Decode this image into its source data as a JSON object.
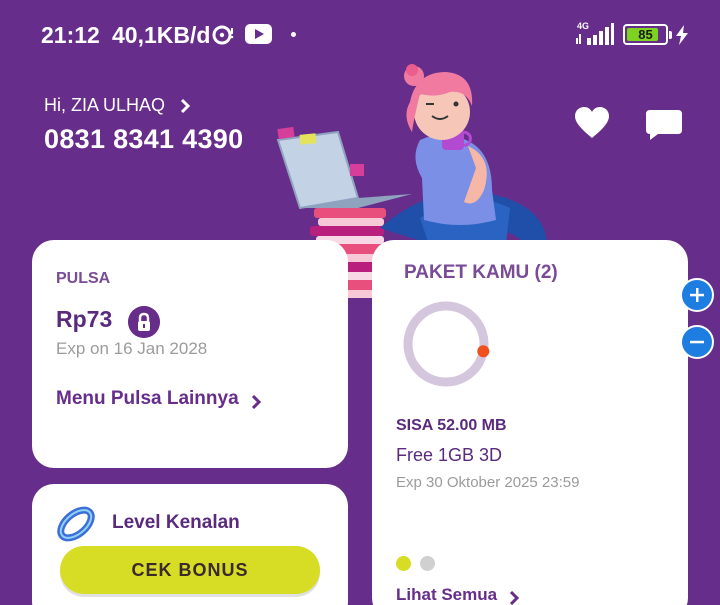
{
  "status_bar": {
    "time": "21:12",
    "speed": "40,1KB/d",
    "network": "4G",
    "battery": "85",
    "battery_fraction": 0.85
  },
  "header": {
    "greeting": "Hi, ZIA ULHAQ",
    "phone": "0831 8341 4390"
  },
  "pulsa": {
    "title": "PULSA",
    "amount": "Rp73",
    "expiry": "Exp on 16 Jan 2028",
    "menu_label": "Menu Pulsa Lainnya"
  },
  "level": {
    "label": "Level Kenalan",
    "button_label": "CEK BONUS"
  },
  "paket": {
    "title": "PAKET KAMU (2)",
    "remaining": "SISA 52.00 MB",
    "name": "Free 1GB 3D",
    "expiry": "Exp 30 Oktober 2025 23:59",
    "link_label": "Lihat Semua",
    "used_fraction": 0.005
  },
  "icons": {
    "disc": "disc-icon",
    "youtube": "youtube-icon",
    "heart": "heart-icon",
    "chat": "chat-icon",
    "lock": "lock-icon",
    "chevron": "chevron-right-icon",
    "plus": "plus-icon",
    "minus": "minus-icon"
  },
  "colors": {
    "background": "#672d8a",
    "accent": "#d7dd25",
    "ring_track": "#d4c6dc",
    "ring_marker": "#f0501e",
    "zoom": "#1e7de0"
  }
}
